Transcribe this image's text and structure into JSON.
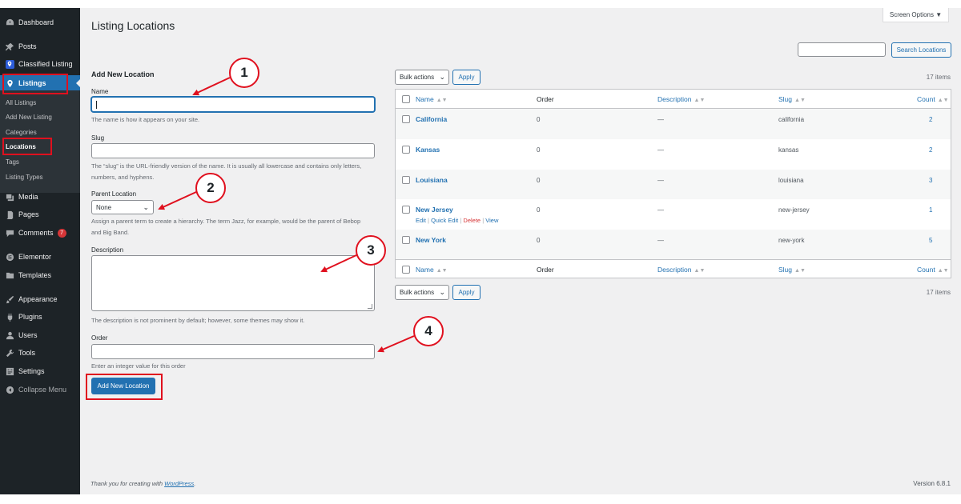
{
  "sidebar": {
    "menu": [
      {
        "label": "Dashboard",
        "icon": "dashboard-icon"
      },
      {
        "label": "Posts",
        "icon": "pin-icon"
      },
      {
        "label": "Classified Listing",
        "icon": "map-pin-icon"
      },
      {
        "label": "Listings",
        "icon": "map-pin-icon"
      },
      {
        "label": "Media",
        "icon": "media-icon"
      },
      {
        "label": "Pages",
        "icon": "pages-icon"
      },
      {
        "label": "Comments",
        "icon": "comment-icon",
        "badge": "7"
      },
      {
        "label": "Elementor",
        "icon": "elementor-icon"
      },
      {
        "label": "Templates",
        "icon": "folder-icon"
      },
      {
        "label": "Appearance",
        "icon": "brush-icon"
      },
      {
        "label": "Plugins",
        "icon": "plugin-icon"
      },
      {
        "label": "Users",
        "icon": "user-icon"
      },
      {
        "label": "Tools",
        "icon": "wrench-icon"
      },
      {
        "label": "Settings",
        "icon": "settings-icon"
      },
      {
        "label": "Collapse Menu",
        "icon": "collapse-icon"
      }
    ],
    "submenu": [
      "All Listings",
      "Add New Listing",
      "Categories",
      "Locations",
      "Tags",
      "Listing Types"
    ]
  },
  "header": {
    "title": "Listing Locations",
    "screen_options": "Screen Options ▼",
    "search_button": "Search Locations",
    "search_value": ""
  },
  "form": {
    "heading": "Add New Location",
    "name_label": "Name",
    "name_value": "",
    "name_help": "The name is how it appears on your site.",
    "slug_label": "Slug",
    "slug_value": "",
    "slug_help": "The “slug” is the URL-friendly version of the name. It is usually all lowercase and contains only letters, numbers, and hyphens.",
    "parent_label": "Parent Location",
    "parent_value": "None",
    "parent_help": "Assign a parent term to create a hierarchy. The term Jazz, for example, would be the parent of Bebop and Big Band.",
    "description_label": "Description",
    "description_help": "The description is not prominent by default; however, some themes may show it.",
    "order_label": "Order",
    "order_value": "",
    "order_help": "Enter an integer value for this order",
    "submit_label": "Add New Location"
  },
  "table": {
    "bulk_label": "Bulk actions",
    "apply_label": "Apply",
    "items_count": "17 items",
    "columns": {
      "name": "Name",
      "order": "Order",
      "description": "Description",
      "slug": "Slug",
      "count": "Count"
    },
    "rows": [
      {
        "name": "California",
        "order": "0",
        "description": "—",
        "slug": "california",
        "count": "2"
      },
      {
        "name": "Kansas",
        "order": "0",
        "description": "—",
        "slug": "kansas",
        "count": "2"
      },
      {
        "name": "Louisiana",
        "order": "0",
        "description": "—",
        "slug": "louisiana",
        "count": "3"
      },
      {
        "name": "New Jersey",
        "order": "0",
        "description": "—",
        "slug": "new-jersey",
        "count": "1"
      },
      {
        "name": "New York",
        "order": "0",
        "description": "—",
        "slug": "new-york",
        "count": "5"
      }
    ],
    "row_actions": {
      "edit": "Edit",
      "quick_edit": "Quick Edit",
      "delete": "Delete",
      "view": "View",
      "sep": "|"
    }
  },
  "footer": {
    "thanks_prefix": "Thank you for creating with ",
    "thanks_link": "WordPress",
    "thanks_suffix": ".",
    "version": "Version 6.8.1"
  },
  "annotations": [
    "1",
    "2",
    "3",
    "4"
  ],
  "colors": {
    "accent": "#2271b1",
    "annotation": "#e0101e",
    "sidebar": "#1d2327",
    "delete": "#d63638"
  }
}
